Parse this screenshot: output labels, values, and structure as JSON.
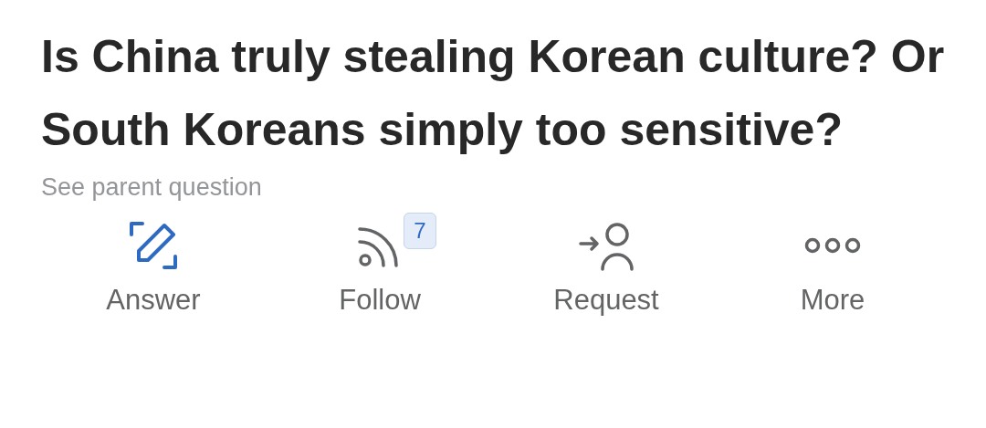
{
  "question": {
    "title": "Is China truly stealing Korean culture? Or South Koreans simply too sensitive?",
    "parent_link": "See parent question"
  },
  "actions": [
    {
      "kind": "answer",
      "label": "Answer"
    },
    {
      "kind": "follow",
      "label": "Follow",
      "badge": "7"
    },
    {
      "kind": "request",
      "label": "Request"
    },
    {
      "kind": "more",
      "label": "More"
    }
  ]
}
